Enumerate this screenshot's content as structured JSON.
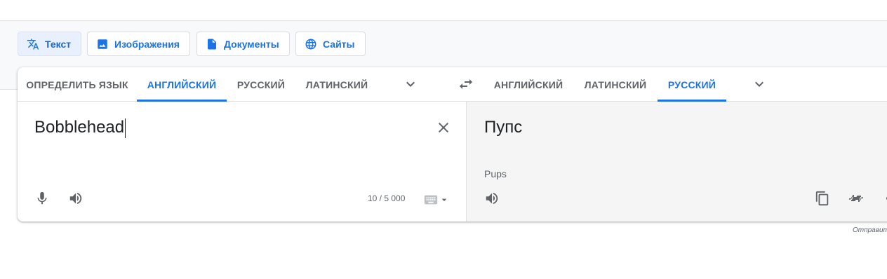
{
  "modes": [
    {
      "label": "Текст",
      "icon": "translate-icon",
      "active": true
    },
    {
      "label": "Изображения",
      "icon": "image-icon",
      "active": false
    },
    {
      "label": "Документы",
      "icon": "document-icon",
      "active": false
    },
    {
      "label": "Сайты",
      "icon": "globe-icon",
      "active": false
    }
  ],
  "source_langs": [
    {
      "label": "ОПРЕДЕЛИТЬ ЯЗЫК",
      "active": false
    },
    {
      "label": "АНГЛИЙСКИЙ",
      "active": true
    },
    {
      "label": "РУССКИЙ",
      "active": false
    },
    {
      "label": "ЛАТИНСКИЙ",
      "active": false
    }
  ],
  "target_langs": [
    {
      "label": "АНГЛИЙСКИЙ",
      "active": false
    },
    {
      "label": "ЛАТИНСКИЙ",
      "active": false
    },
    {
      "label": "РУССКИЙ",
      "active": true
    }
  ],
  "source": {
    "text": "Bobblehead",
    "char_count": "10 / 5 000"
  },
  "target": {
    "text": "Пупс",
    "transliteration": "Pups"
  },
  "footer": {
    "feedback": "Отправит"
  },
  "colors": {
    "accent": "#1a73e8",
    "active_bg": "#e8f0fe",
    "target_bg": "#f5f5f5"
  },
  "icons": [
    "translate-icon",
    "image-icon",
    "document-icon",
    "globe-icon",
    "chevron-down-icon",
    "swap-icon",
    "close-icon",
    "mic-icon",
    "speaker-icon",
    "keyboard-icon",
    "copy-icon",
    "rate-icon",
    "share-icon"
  ]
}
